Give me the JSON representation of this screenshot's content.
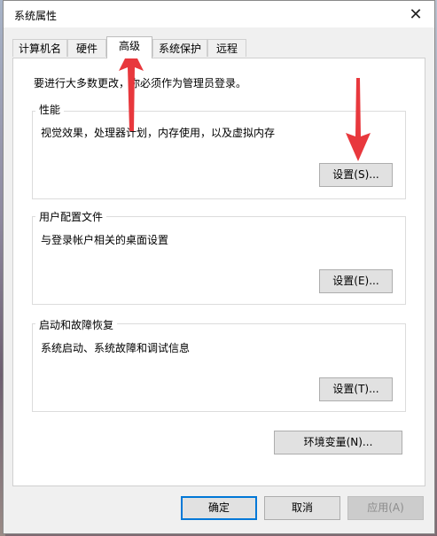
{
  "window": {
    "title": "系统属性"
  },
  "tabs": [
    "计算机名",
    "硬件",
    "高级",
    "系统保护",
    "远程"
  ],
  "active_tab": "高级",
  "notice": "要进行大多数更改，你必须作为管理员登录。",
  "groups": {
    "performance": {
      "title": "性能",
      "desc": "视觉效果，处理器计划，内存使用，以及虚拟内存",
      "button": "设置(S)..."
    },
    "profile": {
      "title": "用户配置文件",
      "desc": "与登录帐户相关的桌面设置",
      "button": "设置(E)..."
    },
    "startup": {
      "title": "启动和故障恢复",
      "desc": "系统启动、系统故障和调试信息",
      "button": "设置(T)..."
    }
  },
  "env_button": "环境变量(N)...",
  "footer": {
    "ok": "确定",
    "cancel": "取消",
    "apply": "应用(A)"
  },
  "colors": {
    "annotation_arrow": "#e8383d",
    "focus_border": "#0078d7"
  }
}
